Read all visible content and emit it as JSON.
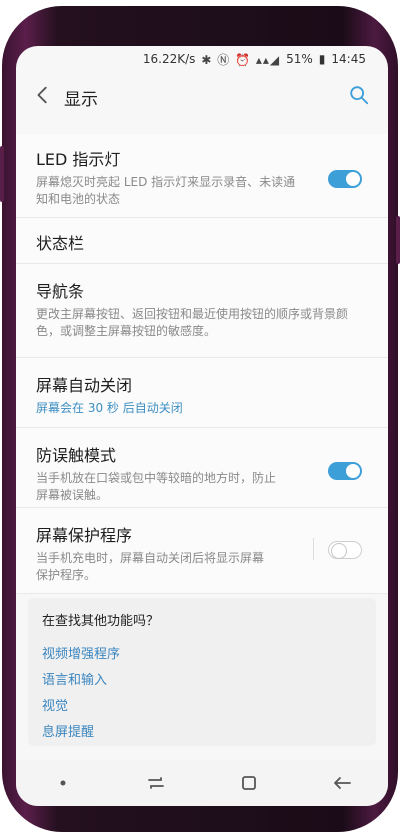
{
  "status_bar": {
    "speed": "16.22K/s",
    "battery": "51%",
    "time": "14:45"
  },
  "header": {
    "title": "显示"
  },
  "settings": [
    {
      "title": "LED 指示灯",
      "desc": "屏幕熄灭时亮起 LED 指示灯来显示录音、未读通知和电池的状态",
      "toggle": "on"
    },
    {
      "title": "状态栏",
      "desc": ""
    },
    {
      "title": "导航条",
      "desc": "更改主屏幕按钮、返回按钮和最近使用按钮的顺序或背景颜色，或调整主屏幕按钮的敏感度。"
    },
    {
      "title": "屏幕自动关闭",
      "desc": "屏幕会在 30 秒 后自动关闭",
      "desc_color": "#3e8fc3"
    },
    {
      "title": "防误触模式",
      "desc": "当手机放在口袋或包中等较暗的地方时，防止屏幕被误触。",
      "toggle": "on"
    },
    {
      "title": "屏幕保护程序",
      "desc": "当手机充电时，屏幕自动关闭后将显示屏幕保护程序。",
      "toggle": "off"
    }
  ],
  "suggestions": {
    "title": "在查找其他功能吗？",
    "links": [
      "视频增强程序",
      "语言和输入",
      "视觉",
      "息屏提醒"
    ]
  },
  "colors": {
    "accent": "#3d9fd8",
    "link": "#3b86bf",
    "phone_frame": "#5a1e4a"
  }
}
